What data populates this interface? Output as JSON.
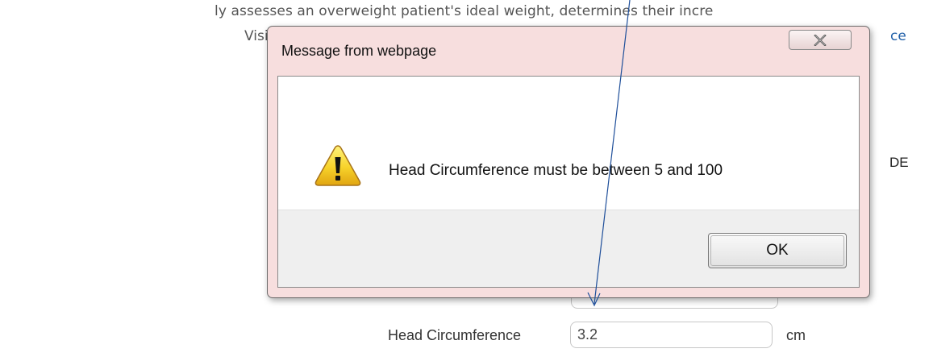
{
  "background": {
    "line1": "ly assesses an overweight patient's ideal weight, determines their incre",
    "line2": "Visit",
    "link_fragment": "ce",
    "right_fragment": "DE"
  },
  "form": {
    "head_circumference_label": "Head Circumference",
    "head_circumference_value": "3.2",
    "head_circumference_unit": "cm"
  },
  "dialog": {
    "title": "Message from webpage",
    "message": "Head Circumference must be between 5 and 100",
    "ok_label": "OK",
    "icon": "warning-icon",
    "close_icon": "close-icon"
  },
  "colors": {
    "dialog_frame": "#f7dede",
    "arrow": "#1f4f9a",
    "link": "#1f5fa8"
  }
}
